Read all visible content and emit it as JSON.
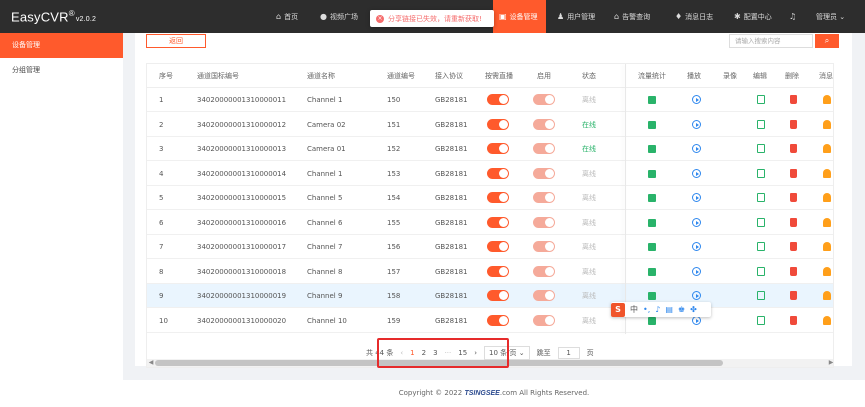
{
  "app": {
    "name": "EasyCVR",
    "reg": "®",
    "version": "v2.0.2"
  },
  "nav": [
    {
      "icon": "home-icon",
      "glyph": "⌂",
      "label": "首页"
    },
    {
      "icon": "video-icon",
      "glyph": "●",
      "label": "视频广场"
    },
    {
      "icon": "device-icon",
      "glyph": "▣",
      "label": "设备管理"
    },
    {
      "icon": "user-icon",
      "glyph": "♟",
      "label": "用户管理"
    },
    {
      "icon": "alarm-icon",
      "glyph": "⌂",
      "label": "告警查询"
    },
    {
      "icon": "log-icon",
      "glyph": "♦",
      "label": "消息日志"
    },
    {
      "icon": "gear-icon",
      "glyph": "✱",
      "label": "配置中心"
    },
    {
      "icon": "bell-icon",
      "glyph": "♫",
      "label": ""
    },
    {
      "icon": "admin-icon",
      "glyph": "",
      "label": "管理员 ⌄"
    }
  ],
  "toast": "分享链接已失效，请重新获取!",
  "sidebar": [
    {
      "label": "设备管理"
    },
    {
      "label": "分组管理"
    }
  ],
  "toolbar": {
    "back": "返回",
    "search_placeholder": "请输入搜索内容",
    "search_glyph": "⌕"
  },
  "table": {
    "headers": [
      "序号",
      "通道国标编号",
      "通道名称",
      "通道编号",
      "接入协议",
      "按需直播",
      "启用",
      "状态",
      "流量统计",
      "播放",
      "录像",
      "编辑",
      "删除",
      "消息"
    ],
    "rows": [
      {
        "no": "1",
        "gb": "34020000001310000011",
        "name": "Channel 1",
        "num": "150",
        "proto": "GB28181",
        "status": "离线"
      },
      {
        "no": "2",
        "gb": "34020000001310000012",
        "name": "Camera 02",
        "num": "151",
        "proto": "GB28181",
        "status": "在线"
      },
      {
        "no": "3",
        "gb": "34020000001310000013",
        "name": "Camera 01",
        "num": "152",
        "proto": "GB28181",
        "status": "在线"
      },
      {
        "no": "4",
        "gb": "34020000001310000014",
        "name": "Channel 1",
        "num": "153",
        "proto": "GB28181",
        "status": "离线"
      },
      {
        "no": "5",
        "gb": "34020000001310000015",
        "name": "Channel 5",
        "num": "154",
        "proto": "GB28181",
        "status": "离线"
      },
      {
        "no": "6",
        "gb": "34020000001310000016",
        "name": "Channel 6",
        "num": "155",
        "proto": "GB28181",
        "status": "离线"
      },
      {
        "no": "7",
        "gb": "34020000001310000017",
        "name": "Channel 7",
        "num": "156",
        "proto": "GB28181",
        "status": "离线"
      },
      {
        "no": "8",
        "gb": "34020000001310000018",
        "name": "Channel 8",
        "num": "157",
        "proto": "GB28181",
        "status": "离线"
      },
      {
        "no": "9",
        "gb": "34020000001310000019",
        "name": "Channel 9",
        "num": "158",
        "proto": "GB28181",
        "status": "离线"
      },
      {
        "no": "10",
        "gb": "34020000001310000020",
        "name": "Channel 10",
        "num": "159",
        "proto": "GB28181",
        "status": "离线"
      }
    ]
  },
  "pagination": {
    "total": "共 44 条",
    "prev": "‹",
    "pages": [
      "1",
      "2",
      "3",
      "···",
      "15"
    ],
    "next": "›",
    "page_size": "10 条/页 ⌄",
    "goto_label": "跳至",
    "goto_value": "1",
    "goto_suffix": "页"
  },
  "ime": {
    "logo": "S",
    "items": [
      "中",
      "•,",
      "♪",
      "▤",
      "♚",
      "✤"
    ]
  },
  "footer": {
    "prefix": "Copyright © 2022 ",
    "brand": "TSINGSEE",
    "suffix": ".com All Rights Reserved."
  },
  "colors": {
    "accent": "#ff5a2c",
    "online": "#29b36a",
    "play": "#2f88ee",
    "delete": "#f04a3a",
    "bell": "#ff9f1a",
    "topbar": "#2d2d2d"
  }
}
